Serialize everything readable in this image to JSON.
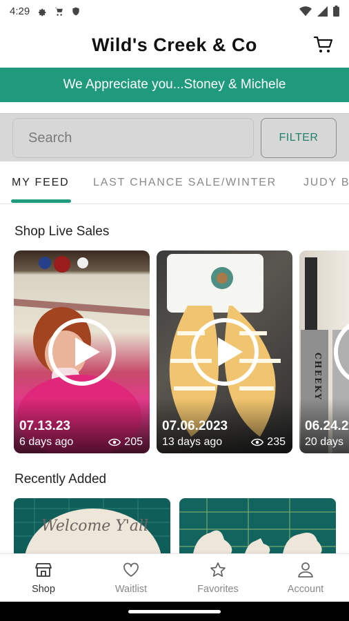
{
  "status": {
    "time": "4:29"
  },
  "header": {
    "title": "Wild's Creek & Co"
  },
  "banner": {
    "text": "We Appreciate you...Stoney & Michele"
  },
  "search": {
    "placeholder": "Search",
    "filter_label": "FILTER"
  },
  "tabs": [
    "MY FEED",
    "LAST CHANCE SALE/WINTER",
    "JUDY B"
  ],
  "sections": {
    "live_sales": "Shop Live Sales",
    "recently_added": "Recently Added"
  },
  "live_sales": [
    {
      "date": "07.13.23",
      "ago": "6 days ago",
      "views": "205"
    },
    {
      "date": "07.06.2023",
      "ago": "13 days ago",
      "views": "235"
    },
    {
      "date": "06.24.2",
      "ago": "20 days"
    }
  ],
  "product_text": {
    "cheeky": "CHEEKY",
    "welcome": "Welcome Y'all"
  },
  "bottom_nav": [
    {
      "label": "Shop",
      "icon": "shop-icon"
    },
    {
      "label": "Waitlist",
      "icon": "heart-icon"
    },
    {
      "label": "Favorites",
      "icon": "star-icon"
    },
    {
      "label": "Account",
      "icon": "person-icon"
    }
  ],
  "colors": {
    "accent": "#1f9a7c",
    "filter_text": "#1f7f68",
    "search_bg": "#d7d7d7"
  }
}
